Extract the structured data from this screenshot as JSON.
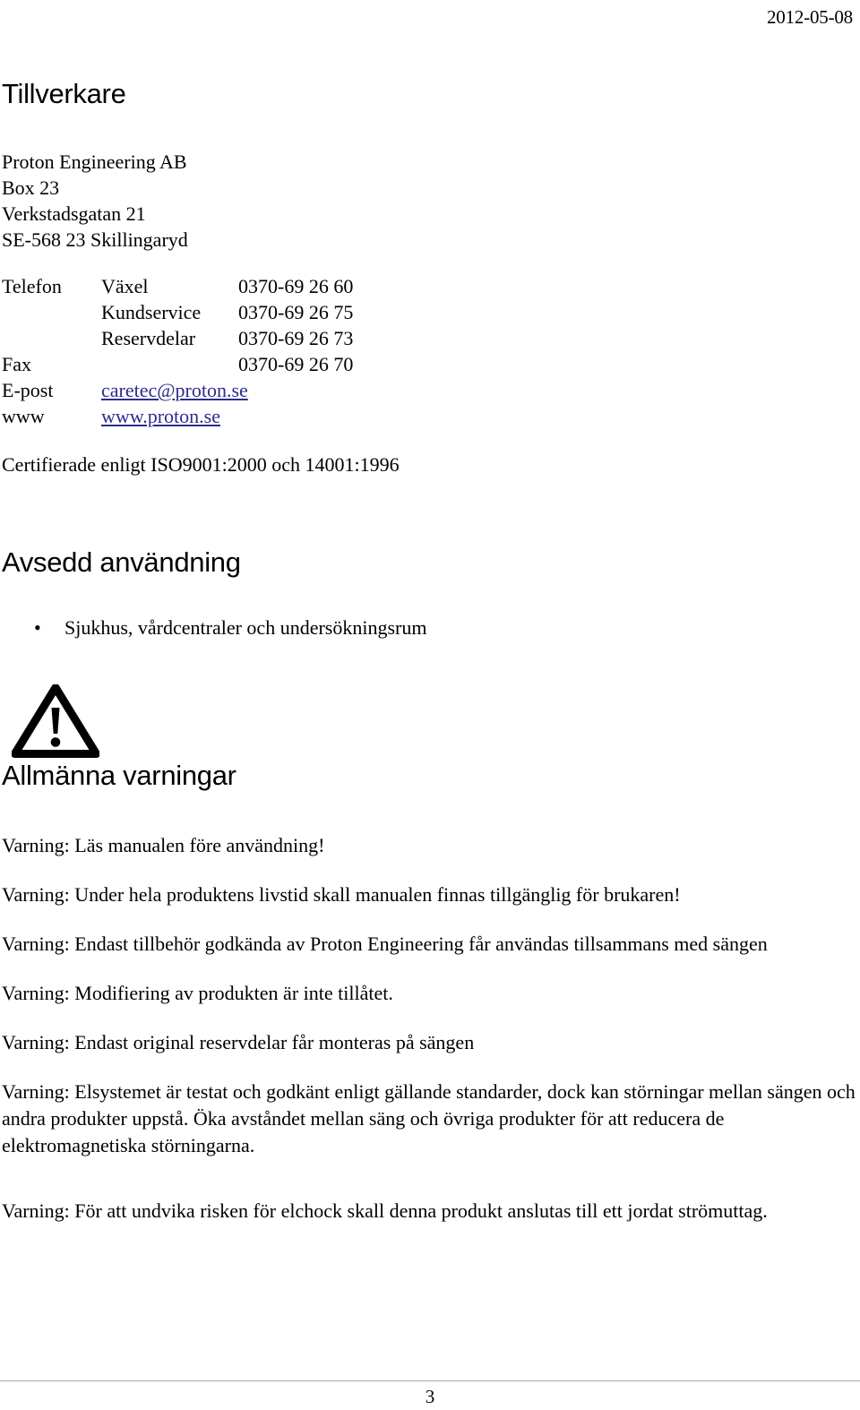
{
  "header": {
    "date": "2012-05-08"
  },
  "sections": {
    "manufacturer_heading": "Tillverkare",
    "intended_use_heading": "Avsedd användning",
    "general_warnings_heading": "Allmänna varningar"
  },
  "address": {
    "line1": "Proton Engineering AB",
    "line2": "Box 23",
    "line3": "Verkstadsgatan 21",
    "line4": "SE-568 23 Skillingaryd"
  },
  "contact": {
    "rows": [
      {
        "label": "Telefon",
        "mid": "Växel",
        "value": "0370-69 26 60"
      },
      {
        "label": "",
        "mid": "Kundservice",
        "value": "0370-69 26 75"
      },
      {
        "label": "",
        "mid": "Reservdelar",
        "value": "0370-69 26 73"
      },
      {
        "label": "Fax",
        "mid": "",
        "value": "0370-69 26 70"
      },
      {
        "label": "E-post",
        "mid": "caretec@proton.se",
        "value": ""
      },
      {
        "label": "www",
        "mid": "www.proton.se",
        "value": ""
      }
    ],
    "email": "caretec@proton.se",
    "website": "www.proton.se"
  },
  "certification": "Certifierade enligt ISO9001:2000 och 14001:1996",
  "intended_use": {
    "bullet_glyph": "•",
    "items": [
      "Sjukhus, vårdcentraler och undersökningsrum"
    ]
  },
  "warnings": {
    "icon": "warning-triangle-icon",
    "items": [
      "Varning: Läs manualen före användning!",
      "Varning: Under hela produktens livstid skall manualen finnas tillgänglig för brukaren!",
      "Varning: Endast tillbehör godkända av Proton Engineering får användas tillsammans med sängen",
      "Varning: Modifiering av produkten är inte tillåtet.",
      "Varning: Endast original reservdelar får monteras på sängen",
      "Varning: Elsystemet är testat och godkänt enligt gällande standarder, dock kan störningar mellan sängen och andra produkter uppstå. Öka avståndet mellan säng och övriga produkter för att reducera de elektromagnetiska störningarna.",
      "Varning: För att undvika risken för elchock skall denna produkt anslutas till ett jordat strömuttag."
    ]
  },
  "footer": {
    "page_number": "3"
  },
  "colors": {
    "link": "#2b2b8f",
    "text": "#000000",
    "rule": "#aaaaaa",
    "background": "#ffffff"
  }
}
